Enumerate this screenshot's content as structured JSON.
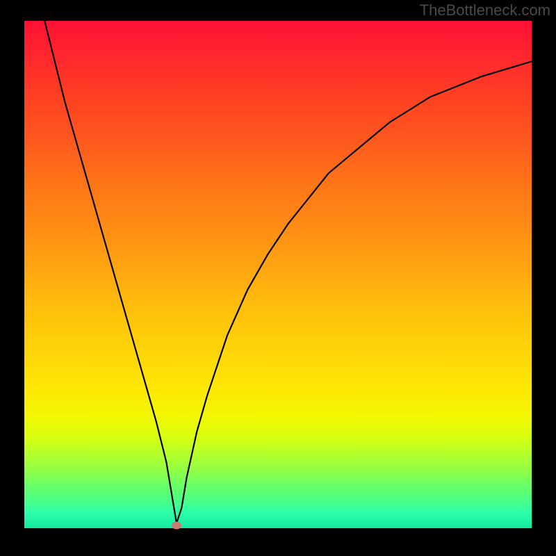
{
  "watermark": "TheBottleneck.com",
  "chart_data": {
    "type": "line",
    "title": "",
    "xlabel": "",
    "ylabel": "",
    "xlim": [
      0,
      100
    ],
    "ylim": [
      0,
      100
    ],
    "background_gradient": {
      "top": "#ff1035",
      "bottom": "#14e8a0",
      "meaning": "red-high to green-low performance bottleneck indicator"
    },
    "series": [
      {
        "name": "bottleneck-curve",
        "color": "#000000",
        "x": [
          4,
          6,
          8,
          10,
          12,
          14,
          16,
          18,
          20,
          22,
          24,
          26,
          28,
          29,
          30,
          31,
          32,
          34,
          36,
          38,
          40,
          44,
          48,
          52,
          56,
          60,
          66,
          72,
          80,
          90,
          100
        ],
        "y": [
          100,
          92,
          84,
          77,
          70,
          63,
          56,
          49,
          42,
          35,
          28,
          21,
          13,
          7,
          1,
          4,
          10,
          19,
          26,
          32,
          38,
          47,
          54,
          60,
          65,
          70,
          75,
          80,
          85,
          89,
          92
        ]
      }
    ],
    "marker": {
      "name": "current-config-point",
      "x": 30,
      "y": 0.5,
      "color": "#cc7a6b"
    }
  }
}
